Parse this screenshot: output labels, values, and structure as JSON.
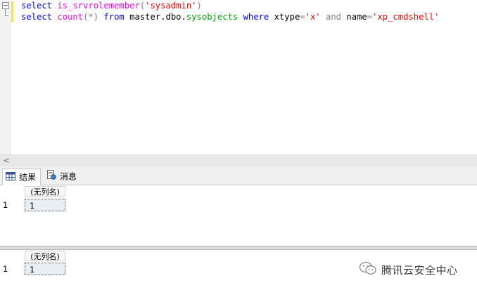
{
  "editor": {
    "line1": {
      "kw_select": "select",
      "fn": "is_srvrolemember",
      "paren_open": "(",
      "arg": "'sysadmin'",
      "paren_close": ")"
    },
    "line2": {
      "kw_select": "select",
      "fn": "count",
      "star": "(*)",
      "kw_from": "from",
      "obj_prefix": "master.dbo.",
      "obj_name": "sysobjects",
      "kw_where": "where",
      "col1": "xtype",
      "eq1": "=",
      "val1": "'x'",
      "kw_and": "and",
      "col2": "name",
      "eq2": "=",
      "val2": "'xp_cmdshell'"
    }
  },
  "scrollbar": {
    "left_arrow": "<"
  },
  "tabs": [
    {
      "label": "结果",
      "icon": "grid-icon",
      "active": true
    },
    {
      "label": "消息",
      "icon": "message-icon",
      "active": false
    }
  ],
  "grids": [
    {
      "column_header": "(无列名)",
      "rows": [
        {
          "row_num": "1",
          "value": "1"
        }
      ]
    },
    {
      "column_header": "(无列名)",
      "rows": [
        {
          "row_num": "1",
          "value": "1"
        }
      ]
    }
  ],
  "watermark": {
    "text": "腾讯云安全中心",
    "icon": "wechat-logo-icon"
  }
}
